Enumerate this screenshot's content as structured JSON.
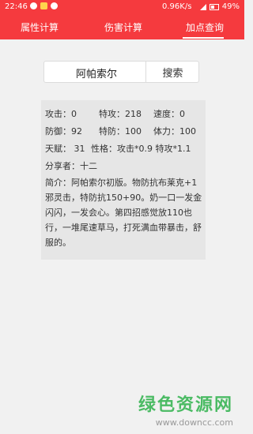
{
  "status_bar": {
    "time": "22:46",
    "speed": "0.96K/s",
    "battery": "49%"
  },
  "tabs": [
    {
      "label": "属性计算"
    },
    {
      "label": "伤害计算"
    },
    {
      "label": "加点查询",
      "active": true
    }
  ],
  "search": {
    "value": "阿帕索尔",
    "button_label": "搜索"
  },
  "stats": {
    "attack": "攻击：0",
    "sp_attack": "特攻：218",
    "speed": "速度：0",
    "defense": "防御：92",
    "sp_defense": "特防：100",
    "hp": "体力：100",
    "talent": "天赋： 31",
    "nature": "性格：攻击*0.9 特攻*1.1",
    "sharer": "分享者：十二",
    "intro": "简介：阿帕索尔初版。物防抗布莱克+1邪灵击，特防抗150+90。奶一口一发金闪闪，一发会心。第四招感觉放110也行，一堆尾速草马，打死满血带暴击，舒服的。"
  },
  "watermark": {
    "logo": "绿色资源网",
    "url": "www.downcc.com"
  },
  "colors": {
    "accent": "#f53a3e",
    "watermark": "#2fb24c"
  }
}
